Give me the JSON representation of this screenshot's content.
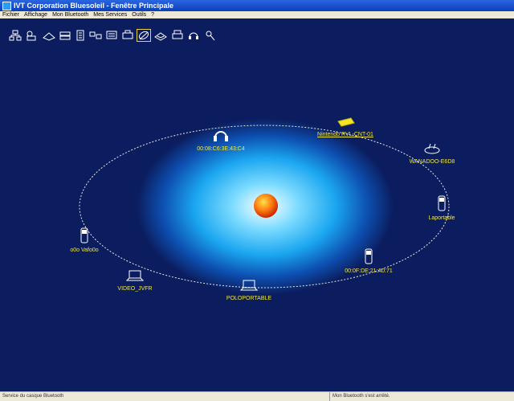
{
  "window": {
    "title": "IVT Corporation Bluesoleil - Fenêtre Principale"
  },
  "menu": [
    "Fichier",
    "Affichage",
    "Mon Bluetooth",
    "Mes Services",
    "Outils",
    "?"
  ],
  "toolbar": {
    "icons": [
      "network-icon",
      "contacts-icon",
      "pan-icon",
      "lan-access-icon",
      "fax-icon",
      "dialup-icon",
      "print-icon",
      "serial-icon",
      "av-icon",
      "obex-icon",
      "printer-icon",
      "headset-icon",
      "hid-icon"
    ],
    "active_index": 9
  },
  "devices": [
    {
      "name": "00:08:C6:3E:43:C4",
      "icon": "headset-icon"
    },
    {
      "name": "Nintendo RVL-CNT-01",
      "icon": "gamepad-icon"
    },
    {
      "name": "WANADOO-E6D8",
      "icon": "modem-icon"
    },
    {
      "name": "Laportable",
      "icon": "phone-icon"
    },
    {
      "name": "00:0F:DE:21:A0:71",
      "icon": "phone-icon"
    },
    {
      "name": "POLOPORTABLE",
      "icon": "laptop-icon"
    },
    {
      "name": "VIDEO_JVFR",
      "icon": "laptop-icon"
    },
    {
      "name": "o0o Vafo0o",
      "icon": "phone-icon"
    }
  ],
  "status": {
    "left": "Service du casque Bluetooth",
    "right": "Mon Bluetooth s'est arrêté."
  }
}
